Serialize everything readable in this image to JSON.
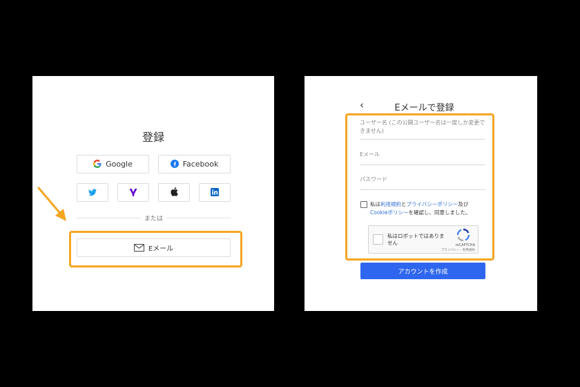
{
  "left": {
    "title": "登録",
    "google_label": "Google",
    "facebook_label": "Facebook",
    "or_text": "または",
    "email_label": "Eメール"
  },
  "right": {
    "back_glyph": "‹",
    "title": "Eメールで登録",
    "username_placeholder": "ユーザー名 (この公開ユーザー名は一度しか変更できません)",
    "email_placeholder": "Eメール",
    "password_placeholder": "パスワード",
    "terms": {
      "prefix": "私は",
      "terms_link": "利用規約",
      "and": "と",
      "privacy_link": "プライバシーポリシー",
      "and2": "及び",
      "cookie_link": "Cookieポリシー",
      "suffix": "を確認し、同意しました。"
    },
    "recaptcha": {
      "label": "私はロボットではありません",
      "brand": "reCAPTCHA",
      "links": "プライバシー - 利用規約"
    },
    "create_button": "アカウントを作成"
  },
  "colors": {
    "highlight": "#f5a623",
    "primary": "#2f66f0",
    "link": "#2f6fd6",
    "background": "#000000"
  }
}
